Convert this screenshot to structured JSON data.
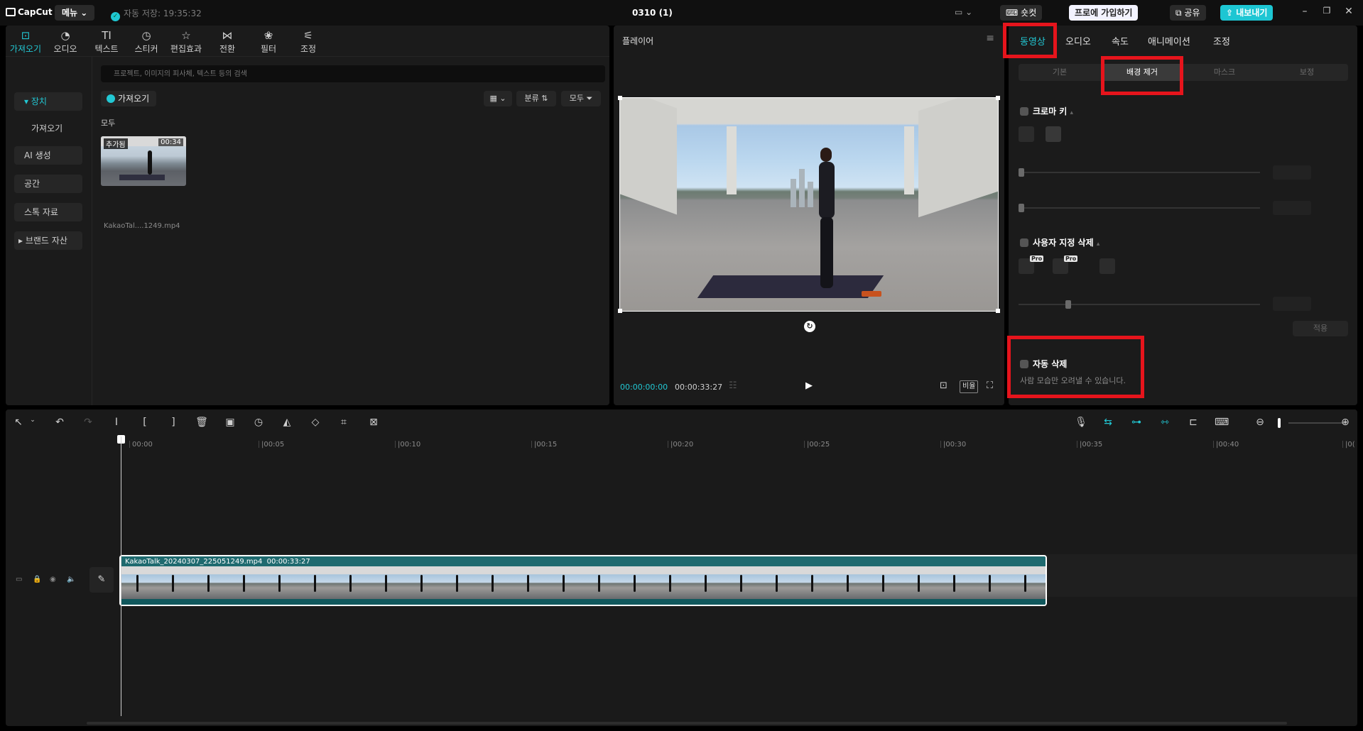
{
  "titlebar": {
    "logo": "CapCut",
    "menu_label": "메뉴",
    "autosave": "자동 저장: 19:35:32",
    "project_name": "0310 (1)",
    "shortcut_label": "숏컷",
    "pro_label": "프로에 가입하기",
    "share_label": "공유",
    "export_label": "내보내기"
  },
  "media": {
    "tabs": [
      {
        "icon": "import-icon",
        "label": "가져오기"
      },
      {
        "icon": "audio-icon",
        "label": "오디오"
      },
      {
        "icon": "text-icon",
        "label": "텍스트"
      },
      {
        "icon": "sticker-icon",
        "label": "스티커"
      },
      {
        "icon": "effects-icon",
        "label": "편집효과"
      },
      {
        "icon": "transition-icon",
        "label": "전환"
      },
      {
        "icon": "filter-icon",
        "label": "필터"
      },
      {
        "icon": "adjust-icon",
        "label": "조정"
      }
    ],
    "sidebar": [
      "장치",
      "가져오기",
      "AI 생성",
      "공간",
      "스톡 자료",
      "브랜드 자산"
    ],
    "search_placeholder": "프로젝트, 이미지의 피사체, 텍스트 등의 검색",
    "import_button": "가져오기",
    "sort_label": "분류",
    "filter_label": "모두",
    "group_label": "모두",
    "item": {
      "badge": "추가됨",
      "duration": "00:34",
      "name": "KakaoTal....1249.mp4"
    }
  },
  "player": {
    "title": "플레이어",
    "current_time": "00:00:00:00",
    "total_time": "00:00:33:27",
    "ratio_label": "비율"
  },
  "inspector": {
    "tabs": [
      "동영상",
      "오디오",
      "속도",
      "애니메이션",
      "조정"
    ],
    "subtabs": [
      "기본",
      "배경 제거",
      "마스크",
      "보정"
    ],
    "chroma_label": "크로마 키",
    "custom_label": "사용자 지정 삭제",
    "pro_tag": "Pro",
    "apply_label": "적용",
    "auto_label": "자동 삭제",
    "auto_desc": "사람 모습만 오려낼 수 있습니다."
  },
  "timeline": {
    "ruler": [
      "00:00",
      "|00:05",
      "|00:10",
      "|00:15",
      "|00:20",
      "|00:25",
      "|00:30",
      "|00:35",
      "|00:40",
      "|0("
    ],
    "clip_name": "KakaoTalk_20240307_225051249.mp4",
    "clip_duration": "00:00:33:27"
  },
  "colors": {
    "accent": "#22c8d4",
    "highlight": "#e6141c",
    "panel": "#1b1b1b"
  }
}
